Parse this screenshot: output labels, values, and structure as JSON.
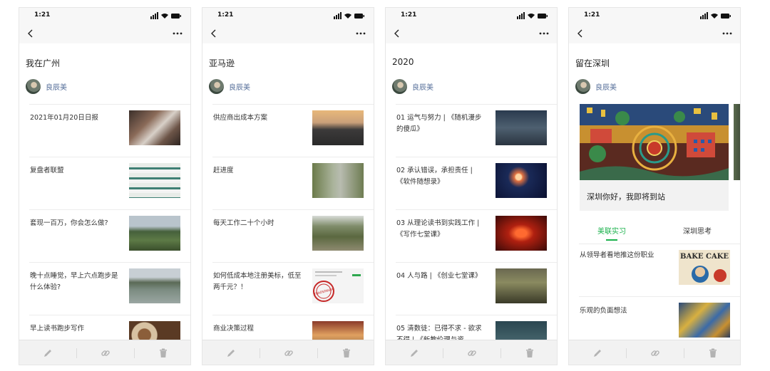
{
  "status_time": "1:21",
  "icons": {
    "back": "chevron-left-icon",
    "more": "more-horizontal-icon",
    "edit": "pencil-icon",
    "link": "link-icon",
    "delete": "trash-icon"
  },
  "colors": {
    "author": "#556e99",
    "tab_active": "#19b14b",
    "toolbar_bg": "#f2f2f2"
  },
  "phones": [
    {
      "title": "我在广州",
      "author": "良辰美",
      "items": [
        {
          "text": "2021年01月20日日报"
        },
        {
          "text": "复盘者联盟"
        },
        {
          "text": "套现一百万，你会怎么做?"
        },
        {
          "text": "晚十点睡觉，早上六点跑步是什么体验?"
        },
        {
          "text": "早上读书跑步写作"
        }
      ]
    },
    {
      "title": "亚马逊",
      "author": "良辰美",
      "items": [
        {
          "text": "供应商出成本方案"
        },
        {
          "text": "赶进度"
        },
        {
          "text": "每天工作二十个小时"
        },
        {
          "text": "如何低成本地注册美标，低至两千元？！",
          "thumb_text": "TRADEMARK"
        },
        {
          "text": "商业决策过程"
        }
      ]
    },
    {
      "title": "2020",
      "author": "良辰美",
      "items": [
        {
          "text": "01 运气与努力 | 《随机漫步的傻瓜》"
        },
        {
          "text": "02 承认错误，承担责任 | 《软件随想录》"
        },
        {
          "text": "03 从理论读书到实践工作 | 《写作七堂课》"
        },
        {
          "text": "04 人与路 | 《创业七堂课》"
        },
        {
          "text": "05 清数徒：已得不求 - 欲求不得 | 《新教伦理与资"
        }
      ]
    },
    {
      "title": "留在深圳",
      "author": "良辰美",
      "banner_caption": "深圳你好，我即将到站",
      "tabs": [
        "美联实习",
        "深圳思考"
      ],
      "items": [
        {
          "text": "从领导者看地推这份职业",
          "thumb_text": "BAKE CAKE"
        },
        {
          "text": "乐观的负面想法"
        }
      ]
    }
  ]
}
